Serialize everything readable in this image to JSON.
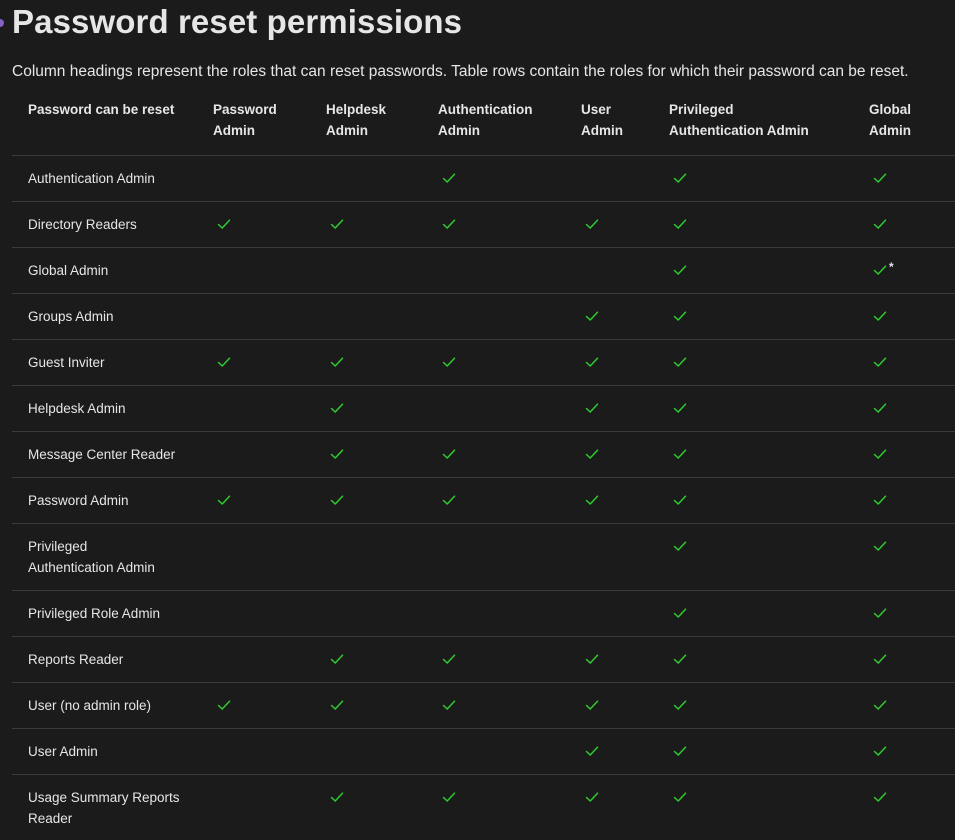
{
  "title": "Password reset permissions",
  "intro": "Column headings represent the roles that can reset passwords. Table rows contain the roles for which their password can be reset.",
  "colors": {
    "background": "#1b1b1b",
    "text": "#e6e6e6",
    "check": "#2ecc2e",
    "divider": "#3b3b3b",
    "bullet": "#8661c5"
  },
  "table": {
    "headers": [
      {
        "line1": "Password can be reset",
        "line2": ""
      },
      {
        "line1": "Password",
        "line2": "Admin"
      },
      {
        "line1": "Helpdesk",
        "line2": "Admin"
      },
      {
        "line1": "Authentication",
        "line2": "Admin"
      },
      {
        "line1": "User",
        "line2": "Admin"
      },
      {
        "line1": "Privileged",
        "line2": "Authentication Admin"
      },
      {
        "line1": "Global",
        "line2": "Admin"
      }
    ],
    "rows": [
      {
        "line1": "Authentication Admin",
        "line2": "",
        "checks": [
          false,
          false,
          true,
          false,
          true,
          true
        ],
        "global_note": ""
      },
      {
        "line1": "Directory Readers",
        "line2": "",
        "checks": [
          true,
          true,
          true,
          true,
          true,
          true
        ],
        "global_note": ""
      },
      {
        "line1": "Global Admin",
        "line2": "",
        "checks": [
          false,
          false,
          false,
          false,
          true,
          true
        ],
        "global_note": "*"
      },
      {
        "line1": "Groups Admin",
        "line2": "",
        "checks": [
          false,
          false,
          false,
          true,
          true,
          true
        ],
        "global_note": ""
      },
      {
        "line1": "Guest Inviter",
        "line2": "",
        "checks": [
          true,
          true,
          true,
          true,
          true,
          true
        ],
        "global_note": ""
      },
      {
        "line1": "Helpdesk Admin",
        "line2": "",
        "checks": [
          false,
          true,
          false,
          true,
          true,
          true
        ],
        "global_note": ""
      },
      {
        "line1": "Message Center Reader",
        "line2": "",
        "checks": [
          false,
          true,
          true,
          true,
          true,
          true
        ],
        "global_note": ""
      },
      {
        "line1": "Password Admin",
        "line2": "",
        "checks": [
          true,
          true,
          true,
          true,
          true,
          true
        ],
        "global_note": ""
      },
      {
        "line1": "Privileged",
        "line2": "Authentication Admin",
        "checks": [
          false,
          false,
          false,
          false,
          true,
          true
        ],
        "global_note": ""
      },
      {
        "line1": "Privileged Role Admin",
        "line2": "",
        "checks": [
          false,
          false,
          false,
          false,
          true,
          true
        ],
        "global_note": ""
      },
      {
        "line1": "Reports Reader",
        "line2": "",
        "checks": [
          false,
          true,
          true,
          true,
          true,
          true
        ],
        "global_note": ""
      },
      {
        "line1": "User (no admin role)",
        "line2": "",
        "checks": [
          true,
          true,
          true,
          true,
          true,
          true
        ],
        "global_note": ""
      },
      {
        "line1": "User Admin",
        "line2": "",
        "checks": [
          false,
          false,
          false,
          true,
          true,
          true
        ],
        "global_note": ""
      },
      {
        "line1": "Usage Summary Reports",
        "line2": "Reader",
        "checks": [
          false,
          true,
          true,
          true,
          true,
          true
        ],
        "global_note": ""
      }
    ]
  }
}
